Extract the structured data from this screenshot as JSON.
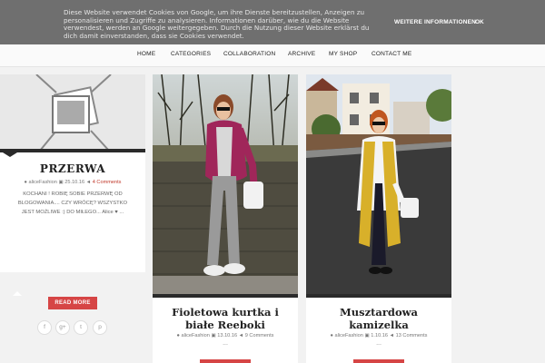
{
  "cookie": {
    "text": "Diese Website verwendet Cookies von Google, um ihre Dienste bereitzustellen, Anzeigen zu personalisieren und Zugriffe zu analysieren. Informationen darüber, wie du die Website verwendest, werden an Google weitergegeben. Durch die Nutzung dieser Website erklärst du dich damit einverstanden, dass sie Cookies verwendet.",
    "more_label": "WEITERE INFORMATIONEN",
    "ok_label": "OK"
  },
  "nav": {
    "items": [
      {
        "label": "HOME"
      },
      {
        "label": "CATEGORIES"
      },
      {
        "label": "COLLABORATION"
      },
      {
        "label": "ARCHIVE"
      },
      {
        "label": "MY SHOP"
      },
      {
        "label": "CONTACT ME"
      }
    ]
  },
  "sidebar_post": {
    "title": "PRZERWA",
    "author": "aliceFashion",
    "date": "25.10.16",
    "comments": "4 Comments",
    "excerpt": "KOCHANI ! ROBIĘ SOBIE PRZERWĘ OD BLOGOWANIA.... CZY WRÓCĘ? WSZYSTKO JEST MOŻLIWE :) DO MIŁEGO... Alice ♥ ...",
    "button_label": "READ MORE",
    "social": [
      "f",
      "g+",
      "t",
      "p"
    ]
  },
  "posts": [
    {
      "title": "Fioletowa kurtka i białe Reeboki",
      "author": "aliceFashion",
      "date": "13.10.16",
      "comments": "9 Comments",
      "more": "..."
    },
    {
      "title": "Musztardowa kamizelka",
      "author": "aliceFashion",
      "date": "1.10.16",
      "comments": "13 Comments",
      "more": "..."
    }
  ],
  "colors": {
    "accent": "#d64545",
    "banner": "#6f6f6f",
    "dark_bar": "#2a2a2a"
  },
  "icons": {
    "placeholder": "image-placeholder-icon",
    "author": "user-icon",
    "date": "calendar-icon",
    "comments": "comment-icon",
    "scroll": "scroll-top-icon"
  }
}
